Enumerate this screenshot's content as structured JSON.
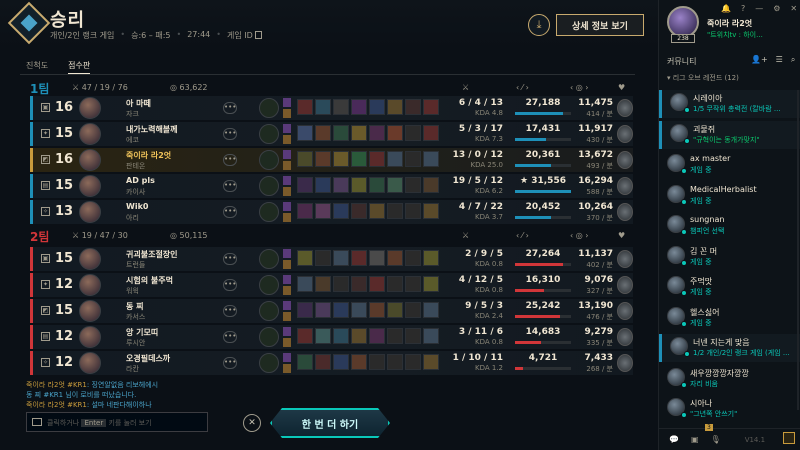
{
  "header": {
    "title": "승리",
    "queue": "개인/2인 랭크 게임",
    "record": "승:6 – 패:5",
    "duration": "27:44",
    "game_id_label": "게임 ID",
    "download_icon": "download-icon",
    "detail_button": "상세 정보 보기"
  },
  "tabs": {
    "growth": "진척도",
    "scoreboard": "점수판"
  },
  "teams": [
    {
      "name": "1팀",
      "color": "#1e90b8",
      "kda": "47 / 19 / 76",
      "gold": "63,622",
      "players": [
        {
          "level": "16",
          "name": "아 마떼",
          "champion": "자크",
          "kda": "6 / 4 / 13",
          "ratio": "KDA 4.8",
          "damage": "27,188",
          "damage_share": 0.86,
          "gold": "11,475",
          "gpm": "414 / 분",
          "items": [
            "#5a2a2a",
            "#2a4a5a",
            "#3a3a3a",
            "#4a2a5a",
            "#2a3a5a",
            "#5a4a2a",
            "#3a2a2a",
            "#5a2a2a"
          ]
        },
        {
          "level": "15",
          "name": "내가노력해볼께",
          "champion": "에코",
          "kda": "5 / 3 / 17",
          "ratio": "KDA 7.3",
          "damage": "17,431",
          "damage_share": 0.55,
          "gold": "11,917",
          "gpm": "430 / 분",
          "items": [
            "#3a4a6a",
            "#5a3a2a",
            "#2a4a3a",
            "#6a5a2a",
            "#4a2a4a",
            "#6a3a2a",
            "#2a2a2a",
            "#5a2a2a"
          ]
        },
        {
          "level": "16",
          "name": "죽이라 라2엇",
          "champion": "판테온",
          "kda": "13 / 0 / 12",
          "ratio": "KDA 25.0",
          "damage": "20,361",
          "damage_share": 0.65,
          "gold": "13,672",
          "gpm": "493 / 분",
          "me": true,
          "items": [
            "#4a4a2a",
            "#5a3a2a",
            "#6a5a2a",
            "#2a5a3a",
            "#5a2a2a",
            "#3a4a5a",
            "#2a2a2a",
            "#3a4a5a"
          ]
        },
        {
          "level": "15",
          "name": "AD pls",
          "champion": "카이사",
          "kda": "19 / 5 / 12",
          "ratio": "KDA 6.2",
          "damage": "★ 31,556",
          "damage_share": 1.0,
          "gold": "16,294",
          "gpm": "588 / 분",
          "items": [
            "#3a2a4a",
            "#2a3a5a",
            "#4a3a5a",
            "#5a5a2a",
            "#2a4a3a",
            "#3a5a4a",
            "#2a2a2a",
            "#4a3a2a"
          ]
        },
        {
          "level": "13",
          "name": "Wik0",
          "champion": "아리",
          "kda": "4 / 7 / 22",
          "ratio": "KDA 3.7",
          "damage": "20,452",
          "damage_share": 0.65,
          "gold": "10,264",
          "gpm": "370 / 분",
          "items": [
            "#4a2a4a",
            "#5a3a5a",
            "#2a3a5a",
            "#3a2a2a",
            "#5a4a2a",
            "#2a2a2a",
            "#2a2a2a",
            "#5a4a2a"
          ]
        }
      ]
    },
    {
      "name": "2팀",
      "color": "#d13639",
      "kda": "19 / 47 / 30",
      "gold": "50,115",
      "players": [
        {
          "level": "15",
          "name": "귀괴불조절장인",
          "champion": "트런들",
          "kda": "2 / 9 / 5",
          "ratio": "KDA 0.8",
          "damage": "27,264",
          "damage_share": 0.86,
          "gold": "11,137",
          "gpm": "402 / 분",
          "items": [
            "#5a5a2a",
            "#2a2a2a",
            "#3a4a5a",
            "#5a2a2a",
            "#4a4a4a",
            "#5a3a2a",
            "#2a2a2a",
            "#5a5a2a"
          ]
        },
        {
          "level": "12",
          "name": "시험의 불주먹",
          "champion": "워윅",
          "kda": "4 / 12 / 5",
          "ratio": "KDA 0.8",
          "damage": "16,310",
          "damage_share": 0.52,
          "gold": "9,076",
          "gpm": "327 / 분",
          "items": [
            "#3a4a5a",
            "#4a3a2a",
            "#2a2a2a",
            "#3a2a2a",
            "#5a2a2a",
            "#2a2a2a",
            "#2a2a2a",
            "#5a5a2a"
          ]
        },
        {
          "level": "15",
          "name": "동 찌",
          "champion": "카서스",
          "kda": "9 / 5 / 3",
          "ratio": "KDA 2.4",
          "damage": "25,242",
          "damage_share": 0.8,
          "gold": "13,190",
          "gpm": "476 / 분",
          "items": [
            "#3a2a4a",
            "#4a3a5a",
            "#2a3a5a",
            "#3a4a5a",
            "#5a3a2a",
            "#4a4a2a",
            "#2a2a2a",
            "#3a4a5a"
          ]
        },
        {
          "level": "12",
          "name": "앙 기모띠",
          "champion": "루시안",
          "kda": "3 / 11 / 6",
          "ratio": "KDA 0.8",
          "damage": "14,683",
          "damage_share": 0.47,
          "gold": "9,279",
          "gpm": "335 / 분",
          "items": [
            "#5a2a2a",
            "#3a5a5a",
            "#2a4a5a",
            "#5a4a2a",
            "#4a2a4a",
            "#2a2a2a",
            "#2a2a2a",
            "#3a4a5a"
          ]
        },
        {
          "level": "12",
          "name": "오경필데스까",
          "champion": "라칸",
          "kda": "1 / 10 / 11",
          "ratio": "KDA 1.2",
          "damage": "4,721",
          "damage_share": 0.15,
          "gold": "7,433",
          "gpm": "268 / 분",
          "items": [
            "#2a4a3a",
            "#4a2a2a",
            "#2a3a5a",
            "#5a3a2a",
            "#2a2a2a",
            "#2a2a2a",
            "#2a2a2a",
            "#5a4a2a"
          ]
        }
      ]
    }
  ],
  "chat": {
    "line1_name": "죽이라 라2엇 #KR1",
    "line1_text": ": 징연알없음 리보헤에시",
    "line2": "동 찌 #KR1 님이 로비를 떠났습니다.",
    "line3_name": "죽이라 라2엇 #KR1",
    "line3_text": ": 설마 네판다해이하나",
    "input_prefix": "클릭하거나",
    "input_key": "Enter",
    "input_suffix": "키를 눌러 보기"
  },
  "actions": {
    "close": "✕",
    "play_again": "한 번 더 하기"
  },
  "social": {
    "my_name": "죽이라 라2엇",
    "my_level": "238",
    "my_status": "\"트위치tv : 하이...",
    "community": "커뮤니티",
    "group": "▾ 리그 오브 레전드 (12)",
    "friends": [
      {
        "name": "시레이아",
        "status": "1/5 무작위 총력전 (칼바람 ...",
        "hl": true
      },
      {
        "name": "괴물쥐",
        "status": "\"규혁이는 동개가맞지\"",
        "hl": true,
        "y": true
      },
      {
        "name": "ax master",
        "status": "게임 중"
      },
      {
        "name": "MedicalHerbalist",
        "status": "게임 중"
      },
      {
        "name": "sungnan",
        "status": "챔피언 선택"
      },
      {
        "name": "김 꼰 머",
        "status": "게임 중"
      },
      {
        "name": "주먹맛",
        "status": "게임 중"
      },
      {
        "name": "헬스싫어",
        "status": "게임 중"
      },
      {
        "name": "너넨 지는게 맞음",
        "status": "1/2 개인/2인 랭크 게임 (게임 ...",
        "hl": true
      },
      {
        "name": "새우깡깡깡자깡깡",
        "status": "자리 비움"
      },
      {
        "name": "시아나",
        "status": "\"그년쪽 안쓰기\""
      }
    ],
    "notif_count": "3",
    "version": "V14.1"
  }
}
